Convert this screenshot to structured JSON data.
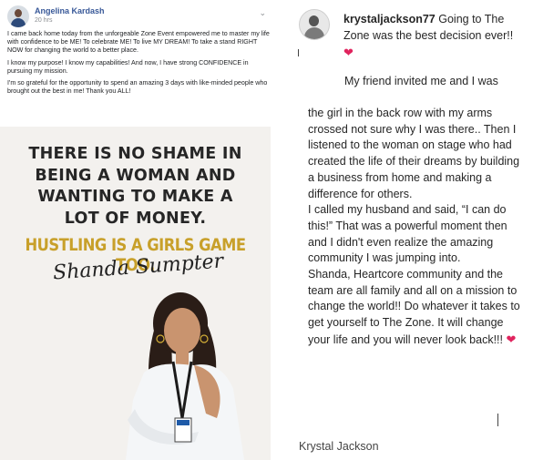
{
  "facebook_post": {
    "author": "Angelina Kardash",
    "time": "20 hrs",
    "paragraphs": [
      "I came back home today from the unforgeable Zone Event empowered me to master my life with confidence to be ME! To celebrate ME! To live MY DREAM! To take a stand RIGHT NOW for changing the world to a better place.",
      "I know my purpose! I know my capabilities! And now, I have strong CONFIDENCE in pursuing my mission.",
      "I'm so grateful for the opportunity to spend an amazing 3 days with like-minded people who brought out the best in me! Thank you ALL!"
    ],
    "poster": {
      "lines": [
        "THERE IS NO SHAME IN",
        "BEING A WOMAN AND",
        "WANTING TO MAKE A",
        "LOT OF MONEY."
      ],
      "highlight": "HUSTLING IS A GIRLS GAME TOO.",
      "signature": "Shanda Sumpter"
    }
  },
  "instagram_comment": {
    "username": "krystaljackson77",
    "top_text": "Going to The Zone was the best decision ever!!",
    "mid_text": "My friend invited me and I was",
    "body_text": "the girl in the back row with my arms crossed not sure why I was there.. Then I listened to the woman on stage who had created the life of their dreams by building a business from home and making a difference for others.\nI called my husband and said, “I can do this!” That was a powerful moment then and I didn't even realize the amazing community I was jumping into.\nShanda, Heartcore community and the team are all family and all on a mission to change the world!! Do whatever it takes to get yourself to The Zone. It will change your life and you will never look back!!!",
    "signature": "Krystal Jackson"
  },
  "icons": {
    "heart": "❤",
    "chevron": "⌄"
  },
  "colors": {
    "fb_link": "#385898",
    "gold": "#c8a02a",
    "heart": "#e0245e"
  }
}
